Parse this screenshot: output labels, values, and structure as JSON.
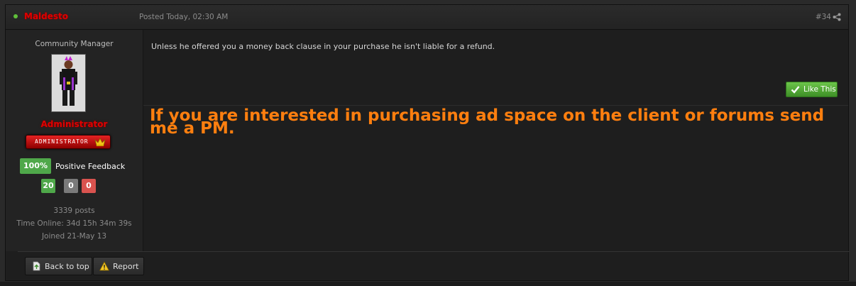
{
  "header": {
    "username": "Maldesto",
    "posted": "Posted Today, 02:30 AM",
    "post_number": "#34"
  },
  "author": {
    "title": "Community Manager",
    "group": "Administrator",
    "rank_badge": "ADMINISTRATOR",
    "feedback_percent": "100%",
    "feedback_label": "Positive Feedback",
    "feedback_positive": "20",
    "feedback_neutral": "0",
    "feedback_negative": "0",
    "posts": "3339 posts",
    "time_online": "Time Online: 34d 15h 34m 39s",
    "joined": "Joined 21-May 13"
  },
  "post": {
    "body": "Unless he offered you a money back clause in your purchase he isn't liable for a refund.",
    "like_label": "Like This",
    "signature": "If you are interested in purchasing ad space on the client or forums send me a PM."
  },
  "footer": {
    "back_to_top": "Back to top",
    "report": "Report"
  },
  "colors": {
    "username": "#e00000",
    "signature": "#ff7f0f",
    "like": "#4fa84a"
  },
  "icons": {
    "share": "share-icon",
    "crown": "crown-icon",
    "like": "checkmark-icon",
    "back_to_top": "page-icon",
    "report": "warning-icon"
  }
}
